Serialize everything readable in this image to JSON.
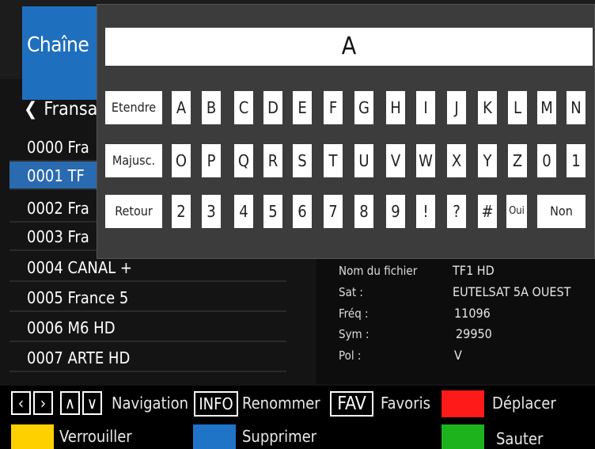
{
  "screen": {
    "title": "Chaîne",
    "satellite": "Fransat",
    "channels": [
      {
        "label": "0000 Fra"
      },
      {
        "label": "0001 TF"
      },
      {
        "label": "0002 Fra"
      },
      {
        "label": "0003 Fra"
      },
      {
        "label": "0004 CANAL +"
      },
      {
        "label": "0005 France 5"
      },
      {
        "label": "0006 M6 HD"
      },
      {
        "label": "0007 ARTE HD"
      }
    ],
    "info": {
      "file_label": "Nom du fichier",
      "file_value": "TF1 HD",
      "sat_label": "Sat :",
      "sat_value": "EUTELSAT  5A OUEST",
      "freq_label": "Fréq :",
      "freq_value": "11096",
      "sym_label": "Sym :",
      "sym_value": "29950",
      "pol_label": "Pol :",
      "pol_value": "V"
    }
  },
  "keyboard": {
    "input_value": "A",
    "row1": [
      "Etendre",
      "A",
      "B",
      "C",
      "D",
      "E",
      "F",
      "G",
      "H",
      "I",
      "J",
      "K",
      "L",
      "M",
      "N"
    ],
    "row2": [
      "Majusc.",
      "O",
      "P",
      "Q",
      "R",
      "S",
      "T",
      "U",
      "V",
      "W",
      "X",
      "Y",
      "Z",
      "0",
      "1"
    ],
    "row3": [
      "Retour",
      "2",
      "3",
      "4",
      "5",
      "6",
      "7",
      "8",
      "9",
      "!",
      "?",
      "#",
      "Oui",
      "Non"
    ]
  },
  "help": {
    "nav_left": "‹",
    "nav_right": "›",
    "nav_up": "∧",
    "nav_down": "∨",
    "navigation": "Navigation",
    "info_key": "INFO",
    "rename": "Renommer",
    "fav_key": "FAV",
    "favorites": "Favoris",
    "move": "Déplacer",
    "lock": "Verrouiller",
    "delete": "Supprimer",
    "skip": "Sauter",
    "colors": {
      "red": "#ff1a1a",
      "yellow": "#ffd000",
      "blue": "#1f74c8",
      "green": "#1db31d"
    }
  }
}
